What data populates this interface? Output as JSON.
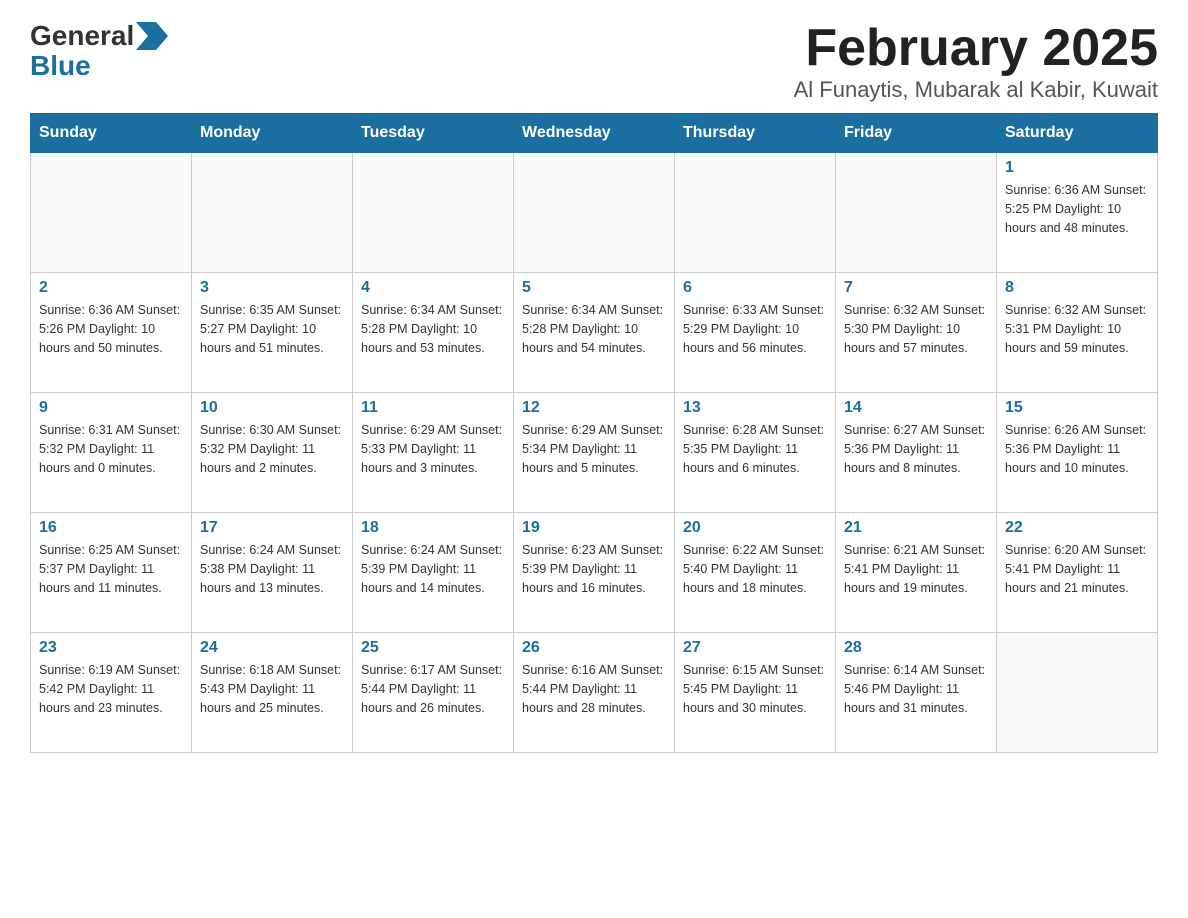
{
  "header": {
    "logo_line1": "General",
    "logo_line2": "Blue",
    "month_title": "February 2025",
    "location": "Al Funaytis, Mubarak al Kabir, Kuwait"
  },
  "weekdays": [
    "Sunday",
    "Monday",
    "Tuesday",
    "Wednesday",
    "Thursday",
    "Friday",
    "Saturday"
  ],
  "weeks": [
    [
      {
        "day": "",
        "info": ""
      },
      {
        "day": "",
        "info": ""
      },
      {
        "day": "",
        "info": ""
      },
      {
        "day": "",
        "info": ""
      },
      {
        "day": "",
        "info": ""
      },
      {
        "day": "",
        "info": ""
      },
      {
        "day": "1",
        "info": "Sunrise: 6:36 AM\nSunset: 5:25 PM\nDaylight: 10 hours\nand 48 minutes."
      }
    ],
    [
      {
        "day": "2",
        "info": "Sunrise: 6:36 AM\nSunset: 5:26 PM\nDaylight: 10 hours\nand 50 minutes."
      },
      {
        "day": "3",
        "info": "Sunrise: 6:35 AM\nSunset: 5:27 PM\nDaylight: 10 hours\nand 51 minutes."
      },
      {
        "day": "4",
        "info": "Sunrise: 6:34 AM\nSunset: 5:28 PM\nDaylight: 10 hours\nand 53 minutes."
      },
      {
        "day": "5",
        "info": "Sunrise: 6:34 AM\nSunset: 5:28 PM\nDaylight: 10 hours\nand 54 minutes."
      },
      {
        "day": "6",
        "info": "Sunrise: 6:33 AM\nSunset: 5:29 PM\nDaylight: 10 hours\nand 56 minutes."
      },
      {
        "day": "7",
        "info": "Sunrise: 6:32 AM\nSunset: 5:30 PM\nDaylight: 10 hours\nand 57 minutes."
      },
      {
        "day": "8",
        "info": "Sunrise: 6:32 AM\nSunset: 5:31 PM\nDaylight: 10 hours\nand 59 minutes."
      }
    ],
    [
      {
        "day": "9",
        "info": "Sunrise: 6:31 AM\nSunset: 5:32 PM\nDaylight: 11 hours\nand 0 minutes."
      },
      {
        "day": "10",
        "info": "Sunrise: 6:30 AM\nSunset: 5:32 PM\nDaylight: 11 hours\nand 2 minutes."
      },
      {
        "day": "11",
        "info": "Sunrise: 6:29 AM\nSunset: 5:33 PM\nDaylight: 11 hours\nand 3 minutes."
      },
      {
        "day": "12",
        "info": "Sunrise: 6:29 AM\nSunset: 5:34 PM\nDaylight: 11 hours\nand 5 minutes."
      },
      {
        "day": "13",
        "info": "Sunrise: 6:28 AM\nSunset: 5:35 PM\nDaylight: 11 hours\nand 6 minutes."
      },
      {
        "day": "14",
        "info": "Sunrise: 6:27 AM\nSunset: 5:36 PM\nDaylight: 11 hours\nand 8 minutes."
      },
      {
        "day": "15",
        "info": "Sunrise: 6:26 AM\nSunset: 5:36 PM\nDaylight: 11 hours\nand 10 minutes."
      }
    ],
    [
      {
        "day": "16",
        "info": "Sunrise: 6:25 AM\nSunset: 5:37 PM\nDaylight: 11 hours\nand 11 minutes."
      },
      {
        "day": "17",
        "info": "Sunrise: 6:24 AM\nSunset: 5:38 PM\nDaylight: 11 hours\nand 13 minutes."
      },
      {
        "day": "18",
        "info": "Sunrise: 6:24 AM\nSunset: 5:39 PM\nDaylight: 11 hours\nand 14 minutes."
      },
      {
        "day": "19",
        "info": "Sunrise: 6:23 AM\nSunset: 5:39 PM\nDaylight: 11 hours\nand 16 minutes."
      },
      {
        "day": "20",
        "info": "Sunrise: 6:22 AM\nSunset: 5:40 PM\nDaylight: 11 hours\nand 18 minutes."
      },
      {
        "day": "21",
        "info": "Sunrise: 6:21 AM\nSunset: 5:41 PM\nDaylight: 11 hours\nand 19 minutes."
      },
      {
        "day": "22",
        "info": "Sunrise: 6:20 AM\nSunset: 5:41 PM\nDaylight: 11 hours\nand 21 minutes."
      }
    ],
    [
      {
        "day": "23",
        "info": "Sunrise: 6:19 AM\nSunset: 5:42 PM\nDaylight: 11 hours\nand 23 minutes."
      },
      {
        "day": "24",
        "info": "Sunrise: 6:18 AM\nSunset: 5:43 PM\nDaylight: 11 hours\nand 25 minutes."
      },
      {
        "day": "25",
        "info": "Sunrise: 6:17 AM\nSunset: 5:44 PM\nDaylight: 11 hours\nand 26 minutes."
      },
      {
        "day": "26",
        "info": "Sunrise: 6:16 AM\nSunset: 5:44 PM\nDaylight: 11 hours\nand 28 minutes."
      },
      {
        "day": "27",
        "info": "Sunrise: 6:15 AM\nSunset: 5:45 PM\nDaylight: 11 hours\nand 30 minutes."
      },
      {
        "day": "28",
        "info": "Sunrise: 6:14 AM\nSunset: 5:46 PM\nDaylight: 11 hours\nand 31 minutes."
      },
      {
        "day": "",
        "info": ""
      }
    ]
  ]
}
